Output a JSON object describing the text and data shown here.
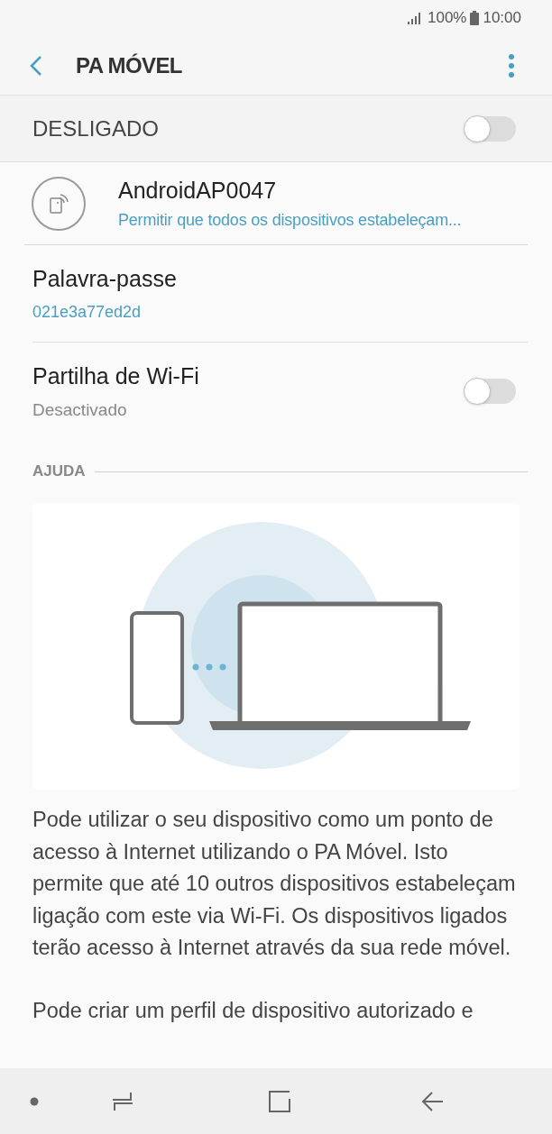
{
  "status_bar": {
    "battery": "100%",
    "time": "10:00"
  },
  "header": {
    "title": "PA MÓVEL"
  },
  "master_switch": {
    "label": "DESLIGADO",
    "on": false
  },
  "network": {
    "name": "AndroidAP0047",
    "detail": "Permitir que todos os dispositivos estabeleçam..."
  },
  "settings": [
    {
      "kind": "text",
      "title": "Palavra-passe",
      "value": "021e3a77ed2d"
    },
    {
      "kind": "toggle",
      "title": "Partilha de Wi-Fi",
      "value": "Desactivado",
      "on": false
    }
  ],
  "help": {
    "heading": "AJUDA",
    "paragraphs": [
      "Pode utilizar o seu dispositivo como um ponto de acesso à Internet utilizando o PA Móvel. Isto permite que até 10 outros dispositivos estabeleçam ligação com este via Wi-Fi. Os dispositivos ligados terão acesso à Internet através da sua rede móvel.",
      "Pode criar um perfil de dispositivo autorizado e"
    ]
  }
}
